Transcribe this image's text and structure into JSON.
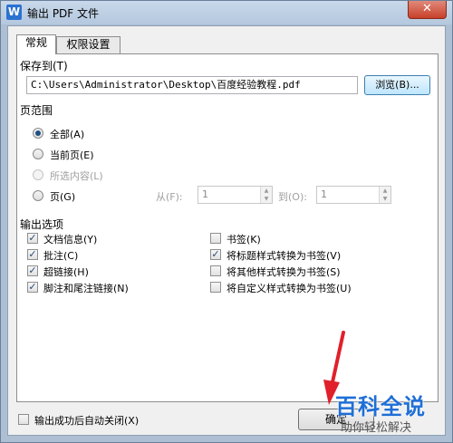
{
  "window": {
    "title": "输出 PDF 文件",
    "icon": "W"
  },
  "tabs": [
    {
      "label": "常规",
      "active": true
    },
    {
      "label": "权限设置",
      "active": false
    }
  ],
  "save_to": {
    "label": "保存到(T)",
    "path": "C:\\Users\\Administrator\\Desktop\\百度经验教程.pdf",
    "browse_label": "浏览(B)..."
  },
  "page_range": {
    "label": "页范围",
    "options": [
      {
        "label": "全部(A)",
        "checked": true,
        "disabled": false
      },
      {
        "label": "当前页(E)",
        "checked": false,
        "disabled": false
      },
      {
        "label": "所选内容(L)",
        "checked": false,
        "disabled": true
      },
      {
        "label": "页(G)",
        "checked": false,
        "disabled": false
      }
    ],
    "from_label": "从(F):",
    "from_value": "1",
    "to_label": "到(O):",
    "to_value": "1"
  },
  "output_options": {
    "label": "输出选项",
    "left": [
      {
        "label": "文档信息(Y)",
        "checked": true
      },
      {
        "label": "批注(C)",
        "checked": true
      },
      {
        "label": "超链接(H)",
        "checked": true
      },
      {
        "label": "脚注和尾注链接(N)",
        "checked": true
      }
    ],
    "right": [
      {
        "label": "书签(K)",
        "checked": false
      },
      {
        "label": "将标题样式转换为书签(V)",
        "checked": true
      },
      {
        "label": "将其他样式转换为书签(S)",
        "checked": false
      },
      {
        "label": "将自定义样式转换为书签(U)",
        "checked": false
      }
    ]
  },
  "footer": {
    "auto_close_label": "输出成功后自动关闭(X)",
    "ok_label": "确定"
  },
  "watermark": {
    "title": "百科全说",
    "subtitle": "助你轻松解决"
  },
  "colors": {
    "accent_arrow": "#e0202a",
    "watermark_blue": "#1f6fd6"
  }
}
